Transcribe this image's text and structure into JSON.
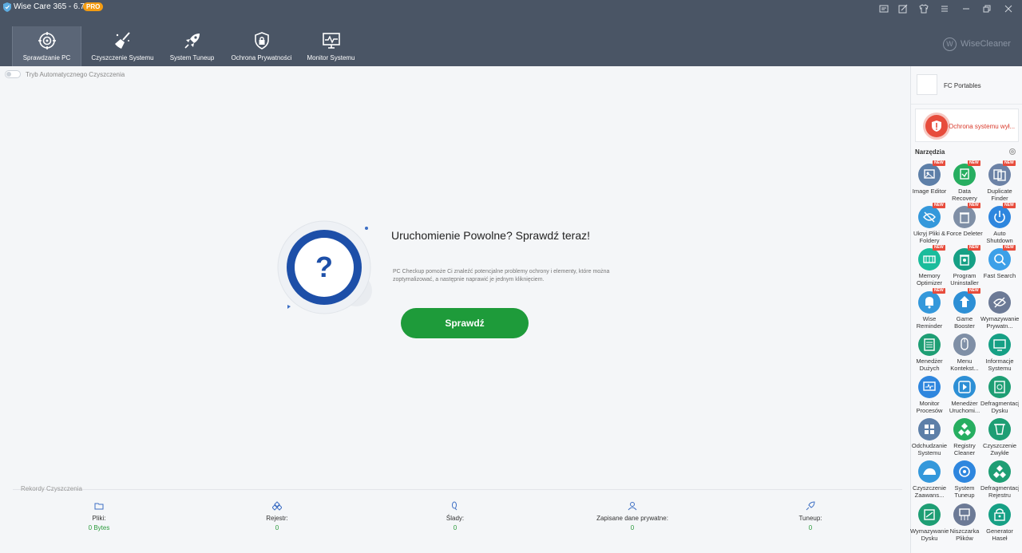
{
  "titlebar": {
    "title": "Wise Care 365 - 6.7.5",
    "badge": "PRO"
  },
  "nav": {
    "tabs": [
      {
        "label": "Sprawdzanie PC",
        "icon": "target-icon"
      },
      {
        "label": "Czyszczenie Systemu",
        "icon": "broom-icon"
      },
      {
        "label": "System Tuneup",
        "icon": "rocket-icon"
      },
      {
        "label": "Ochrona Prywatności",
        "icon": "lock-shield-icon"
      },
      {
        "label": "Monitor Systemu",
        "icon": "monitor-icon"
      }
    ],
    "brand": "WiseCleaner",
    "brand_logo": "W"
  },
  "auto_clean": {
    "label": "Tryb Automatycznego Czyszczenia"
  },
  "main": {
    "title": "Uruchomienie Powolne? Sprawdź teraz!",
    "description": "PC Checkup pomoże Ci znaleźć potencjalne problemy ochrony i elementy, które można zoptymalizować, a następnie naprawić je jednym kliknięciem.",
    "button": "Sprawdź",
    "question_mark": "?"
  },
  "records": {
    "title": "Rekordy Czyszczenia",
    "items": [
      {
        "label": "Pliki:",
        "value": "0 Bytes"
      },
      {
        "label": "Rejestr:",
        "value": "0"
      },
      {
        "label": "Ślady:",
        "value": "0"
      },
      {
        "label": "Zapisane dane prywatne:",
        "value": "0"
      },
      {
        "label": "Tuneup:",
        "value": "0"
      }
    ]
  },
  "sidebar": {
    "profile_name": "FC Portables",
    "protection_status": "Ochrona systemu wył...",
    "tools_title": "Narzędzia",
    "new_badge": "NEW",
    "tools": [
      {
        "label": "Image Editor",
        "color": "#5d7fa8",
        "new": true
      },
      {
        "label": "Data Recovery",
        "color": "#27ae60",
        "new": true
      },
      {
        "label": "Duplicate Finder",
        "color": "#6c82a6",
        "new": true
      },
      {
        "label": "Ukryj Pliki & Foldery",
        "color": "#3498db",
        "new": true
      },
      {
        "label": "Force Deleter",
        "color": "#7f8fa6",
        "new": true
      },
      {
        "label": "Auto Shutdown",
        "color": "#2e86de",
        "new": true
      },
      {
        "label": "Memory Optimizer",
        "color": "#1abc9c",
        "new": true
      },
      {
        "label": "Program Uninstaller",
        "color": "#16a085",
        "new": true
      },
      {
        "label": "Fast Search",
        "color": "#3ca0e8",
        "new": true
      },
      {
        "label": "Wise Reminder",
        "color": "#3498db",
        "new": true
      },
      {
        "label": "Game Booster",
        "color": "#2d8fd5",
        "new": true
      },
      {
        "label": "Wymazywanie Prywatn...",
        "color": "#6c7a96",
        "new": false
      },
      {
        "label": "Menedżer Dużych Plików",
        "color": "#1e9e74",
        "new": false
      },
      {
        "label": "Menu Kontekst...",
        "color": "#7f8fa6",
        "new": false
      },
      {
        "label": "Informacje Systemu",
        "color": "#16a085",
        "new": false
      },
      {
        "label": "Monitor Procesów",
        "color": "#2e86de",
        "new": false
      },
      {
        "label": "Menedżer Uruchomi...",
        "color": "#2d8fd5",
        "new": false
      },
      {
        "label": "Defragmentacja Dysku",
        "color": "#1e9e74",
        "new": false
      },
      {
        "label": "Odchudzanie Systemu",
        "color": "#5d7fa8",
        "new": false
      },
      {
        "label": "Registry Cleaner",
        "color": "#27ae60",
        "new": false
      },
      {
        "label": "Czyszczenie Zwykłe",
        "color": "#1e9e74",
        "new": false
      },
      {
        "label": "Czyszczenie Zaawans...",
        "color": "#3498db",
        "new": false
      },
      {
        "label": "System Tuneup",
        "color": "#2e86de",
        "new": false
      },
      {
        "label": "Defragmentacja Rejestru",
        "color": "#1e9e74",
        "new": false
      },
      {
        "label": "Wymazywanie Dysku",
        "color": "#1e9e74",
        "new": false
      },
      {
        "label": "Niszczarka Plików",
        "color": "#6c7a96",
        "new": false
      },
      {
        "label": "Generator Haseł",
        "color": "#16a085",
        "new": false
      }
    ]
  }
}
